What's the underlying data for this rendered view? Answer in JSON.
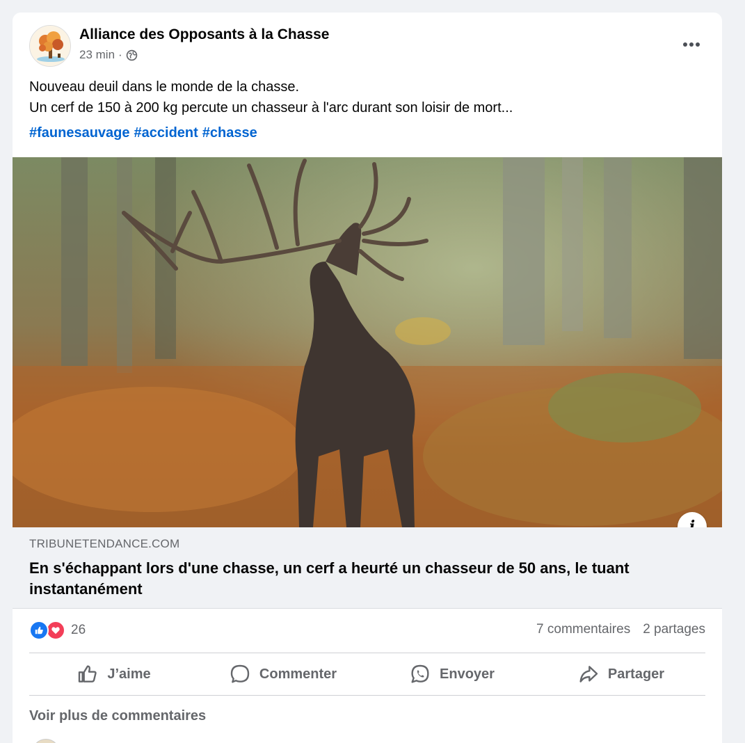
{
  "post": {
    "page_name": "Alliance des Opposants à la Chasse",
    "time": "23 min",
    "separator": "·",
    "text_line1": "Nouveau deuil dans le monde de la chasse.",
    "text_line2": "Un cerf de 150 à 200 kg percute un chasseur à l'arc durant son loisir de mort...",
    "hashtags": [
      "#faunesauvage",
      "#accident",
      "#chasse"
    ]
  },
  "link_preview": {
    "domain": "TRIBUNETENDANCE.COM",
    "title": "En s'échappant lors d'une chasse, un cerf a heurté un chasseur de 50 ans, le tuant instantanément",
    "info_icon": "i"
  },
  "stats": {
    "reaction_count": "26",
    "comments": "7 commentaires",
    "shares": "2 partages"
  },
  "actions": {
    "like": "J’aime",
    "comment": "Commenter",
    "send": "Envoyer",
    "share": "Partager"
  },
  "comments_section": {
    "more_comments": "Voir plus de commentaires"
  },
  "colors": {
    "hashtag": "#0064d1",
    "like_blue": "#1877f2",
    "love_red": "#f33e58",
    "secondary_text": "#65676b"
  },
  "icons": {
    "globe": "globe-icon",
    "more": "more-horizontal-icon",
    "like": "thumbs-up-icon",
    "comment": "speech-bubble-icon",
    "send": "whatsapp-icon",
    "share": "share-arrow-icon",
    "info": "info-icon"
  }
}
